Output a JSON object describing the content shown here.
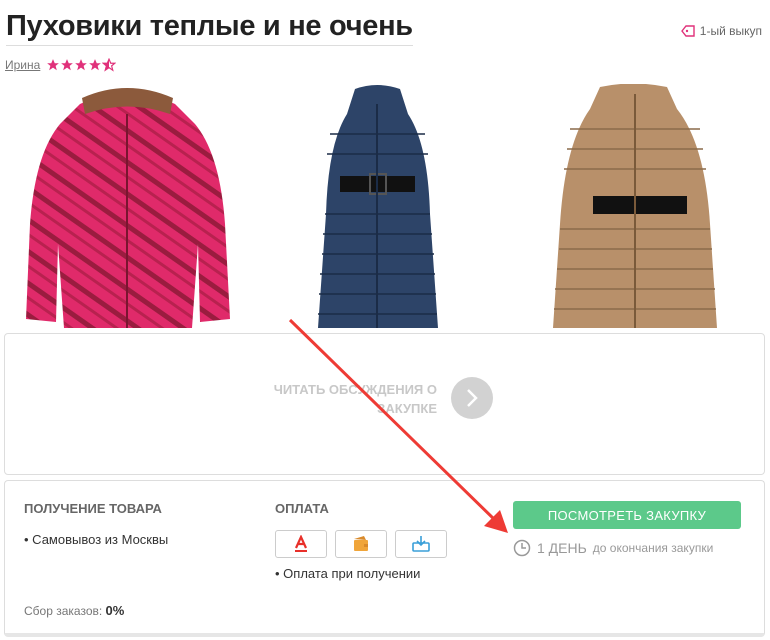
{
  "title": "Пуховики теплые и не очень",
  "badge_label": "1-ый выкуп",
  "author": "Ирина",
  "rating": 4.5,
  "colors": {
    "accent_pink": "#e0317a",
    "button_green": "#5cc98a",
    "arrow_red": "#ee3b35"
  },
  "discussion_label": "ЧИТАТЬ ОБСУЖДЕНИЯ О ЗАКУПКЕ",
  "delivery": {
    "heading": "ПОЛУЧЕНИЕ ТОВАРА",
    "item": "• Самовывоз из Москвы"
  },
  "payment": {
    "heading": "ОПЛАТА",
    "icons": [
      "alfa-bank-icon",
      "wallet-icon",
      "transfer-icon"
    ],
    "item": "• Оплата при получении"
  },
  "view_button": "ПОСМОТРЕТЬ ЗАКУПКУ",
  "timer": {
    "value": "1 ДЕНЬ",
    "suffix": "до окончания закупки"
  },
  "orders": {
    "label": "Сбор заказов:",
    "value": "0%"
  }
}
